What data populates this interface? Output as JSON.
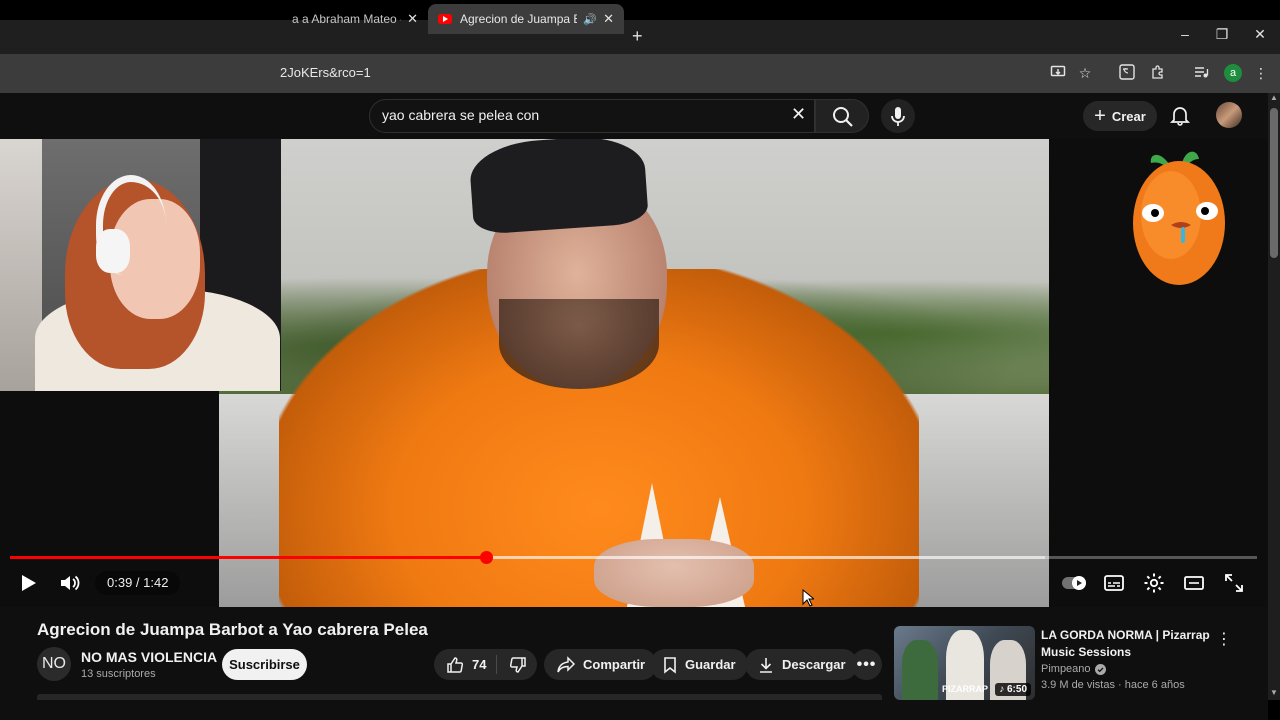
{
  "browser": {
    "tabs": [
      {
        "label": "a a Abraham Mateo - Día",
        "active": false
      },
      {
        "label": "Agrecion de Juampa Barbot",
        "active": true,
        "audio": true
      }
    ],
    "address_fragment": "2JoKErs&rco=1",
    "profile_initial": "a"
  },
  "youtube": {
    "search_query": "yao cabrera se pelea con",
    "create_label": "Crear"
  },
  "player": {
    "time": "0:39 / 1:42",
    "progress_fraction": 0.382,
    "buffer_fraction": 0.83
  },
  "video": {
    "title": "Agrecion de Juampa Barbot a Yao cabrera Pelea",
    "channel_initials": "NO",
    "channel_name": "NO MAS VIOLENCIA",
    "subscribers": "13 suscriptores",
    "subscribe_label": "Suscribirse",
    "likes": "74",
    "share_label": "Compartir",
    "save_label": "Guardar",
    "download_label": "Descargar"
  },
  "recommendation": {
    "title": "LA GORDA NORMA | Pizarrap Music Sessions",
    "channel": "Pimpeano",
    "meta": "3.9 M de vistas · hace 6 años",
    "duration": "6:50",
    "thumb_text": "PIZARRAP"
  },
  "colors": {
    "accent": "#ff0000",
    "background": "#0f0f0f",
    "pill": "#272727"
  }
}
